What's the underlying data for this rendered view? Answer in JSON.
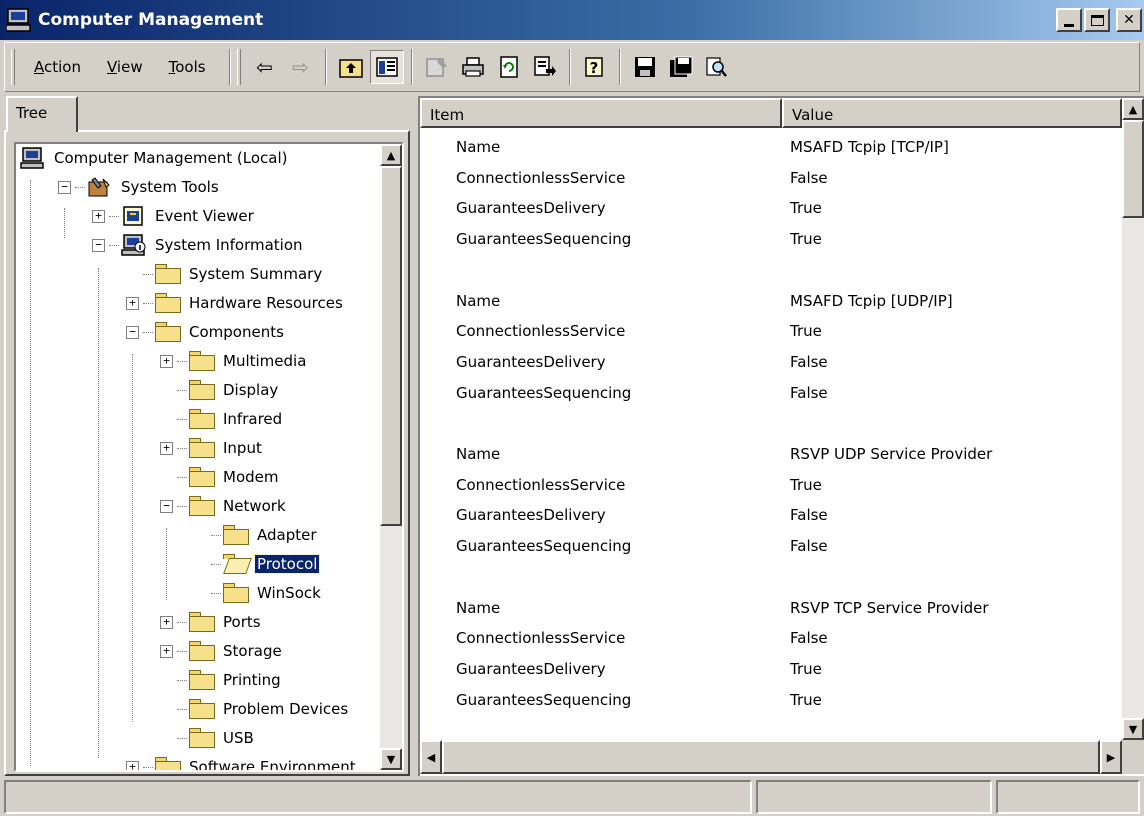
{
  "window": {
    "title": "Computer Management"
  },
  "menu": [
    {
      "label": "Action",
      "mnemonic": "A",
      "rest": "ction"
    },
    {
      "label": "View",
      "mnemonic": "V",
      "rest": "iew"
    },
    {
      "label": "Tools",
      "mnemonic": "T",
      "rest": "ools"
    }
  ],
  "toolbar_icons": [
    "back-arrow-icon",
    "forward-arrow-icon",
    "up-folder-icon",
    "show-hide-tree-icon",
    "properties-icon",
    "print-icon",
    "refresh-icon",
    "export-list-icon",
    "help-icon",
    "save-icon",
    "save-as-icon",
    "find-icon"
  ],
  "tree_tab": {
    "label": "Tree"
  },
  "tree": [
    {
      "label": "Computer Management (Local)",
      "level": 0,
      "icon": "computer-icon",
      "expander": "none"
    },
    {
      "label": "System Tools",
      "level": 1,
      "icon": "tools-icon",
      "expander": "minus"
    },
    {
      "label": "Event Viewer",
      "level": 2,
      "icon": "event-viewer-icon",
      "expander": "plus"
    },
    {
      "label": "System Information",
      "level": 2,
      "icon": "system-info-icon",
      "expander": "minus"
    },
    {
      "label": "System Summary",
      "level": 3,
      "icon": "folder-icon",
      "expander": "none"
    },
    {
      "label": "Hardware Resources",
      "level": 3,
      "icon": "folder-icon",
      "expander": "plus"
    },
    {
      "label": "Components",
      "level": 3,
      "icon": "folder-icon",
      "expander": "minus"
    },
    {
      "label": "Multimedia",
      "level": 4,
      "icon": "folder-icon",
      "expander": "plus"
    },
    {
      "label": "Display",
      "level": 4,
      "icon": "folder-icon",
      "expander": "none"
    },
    {
      "label": "Infrared",
      "level": 4,
      "icon": "folder-icon",
      "expander": "none"
    },
    {
      "label": "Input",
      "level": 4,
      "icon": "folder-icon",
      "expander": "plus"
    },
    {
      "label": "Modem",
      "level": 4,
      "icon": "folder-icon",
      "expander": "none"
    },
    {
      "label": "Network",
      "level": 4,
      "icon": "folder-icon",
      "expander": "minus"
    },
    {
      "label": "Adapter",
      "level": 5,
      "icon": "folder-icon",
      "expander": "none"
    },
    {
      "label": "Protocol",
      "level": 5,
      "icon": "open-folder-icon",
      "expander": "none",
      "selected": true
    },
    {
      "label": "WinSock",
      "level": 5,
      "icon": "folder-icon",
      "expander": "none"
    },
    {
      "label": "Ports",
      "level": 4,
      "icon": "folder-icon",
      "expander": "plus"
    },
    {
      "label": "Storage",
      "level": 4,
      "icon": "folder-icon",
      "expander": "plus"
    },
    {
      "label": "Printing",
      "level": 4,
      "icon": "folder-icon",
      "expander": "none"
    },
    {
      "label": "Problem Devices",
      "level": 4,
      "icon": "folder-icon",
      "expander": "none"
    },
    {
      "label": "USB",
      "level": 4,
      "icon": "folder-icon",
      "expander": "none"
    },
    {
      "label": "Software Environment",
      "level": 3,
      "icon": "folder-icon",
      "expander": "plus"
    }
  ],
  "list": {
    "columns": [
      "Item",
      "Value"
    ],
    "rows": [
      [
        "Name",
        "MSAFD Tcpip [TCP/IP]"
      ],
      [
        "ConnectionlessService",
        "False"
      ],
      [
        "GuaranteesDelivery",
        "True"
      ],
      [
        "GuaranteesSequencing",
        "True"
      ],
      [
        "",
        ""
      ],
      [
        "Name",
        "MSAFD Tcpip [UDP/IP]"
      ],
      [
        "ConnectionlessService",
        "True"
      ],
      [
        "GuaranteesDelivery",
        "False"
      ],
      [
        "GuaranteesSequencing",
        "False"
      ],
      [
        "",
        ""
      ],
      [
        "Name",
        "RSVP UDP Service Provider"
      ],
      [
        "ConnectionlessService",
        "True"
      ],
      [
        "GuaranteesDelivery",
        "False"
      ],
      [
        "GuaranteesSequencing",
        "False"
      ],
      [
        "",
        ""
      ],
      [
        "Name",
        "RSVP TCP Service Provider"
      ],
      [
        "ConnectionlessService",
        "False"
      ],
      [
        "GuaranteesDelivery",
        "True"
      ],
      [
        "GuaranteesSequencing",
        "True"
      ]
    ]
  },
  "colors": {
    "title_start": "#0a246a",
    "title_end": "#a6caf0",
    "selection": "#0a246a",
    "face": "#d4d0c8"
  }
}
